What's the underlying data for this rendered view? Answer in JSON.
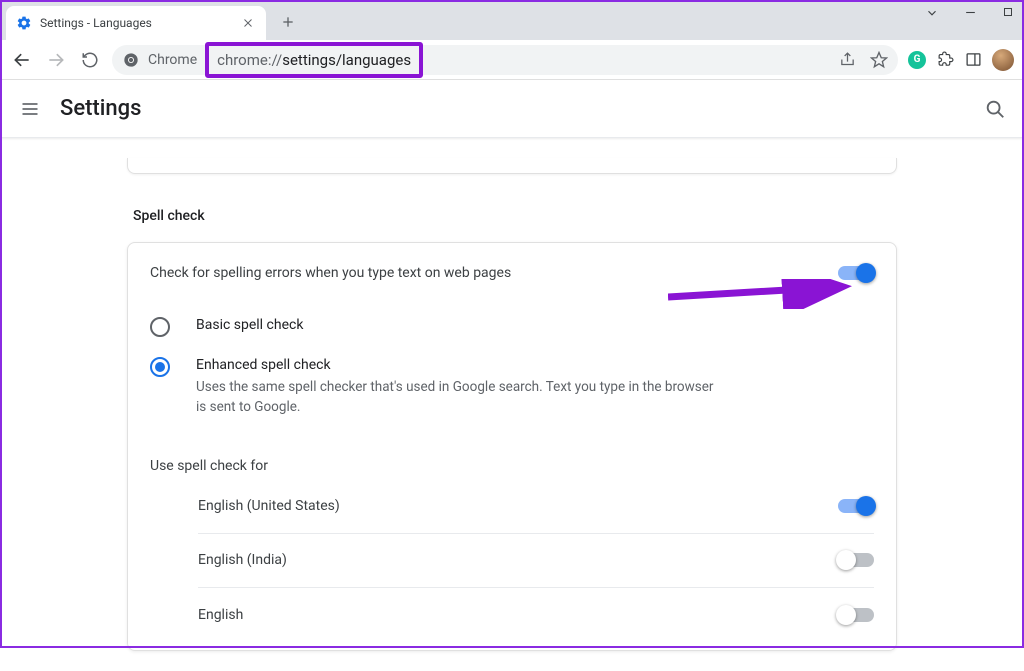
{
  "tab": {
    "title": "Settings - Languages"
  },
  "url": {
    "chromeLabel": "Chrome",
    "part1": "chrome://",
    "part2": "settings/languages"
  },
  "settingsHeader": {
    "title": "Settings"
  },
  "spellcheck": {
    "section_label": "Spell check",
    "main_toggle_label": "Check for spelling errors when you type text on web pages",
    "main_toggle_on": true,
    "options": {
      "basic": {
        "title": "Basic spell check"
      },
      "enhanced": {
        "title": "Enhanced spell check",
        "desc": "Uses the same spell checker that's used in Google search. Text you type in the browser is sent to Google."
      }
    },
    "use_for_label": "Use spell check for",
    "languages": [
      {
        "name": "English (United States)",
        "on": true
      },
      {
        "name": "English (India)",
        "on": false
      },
      {
        "name": "English",
        "on": false
      }
    ]
  }
}
